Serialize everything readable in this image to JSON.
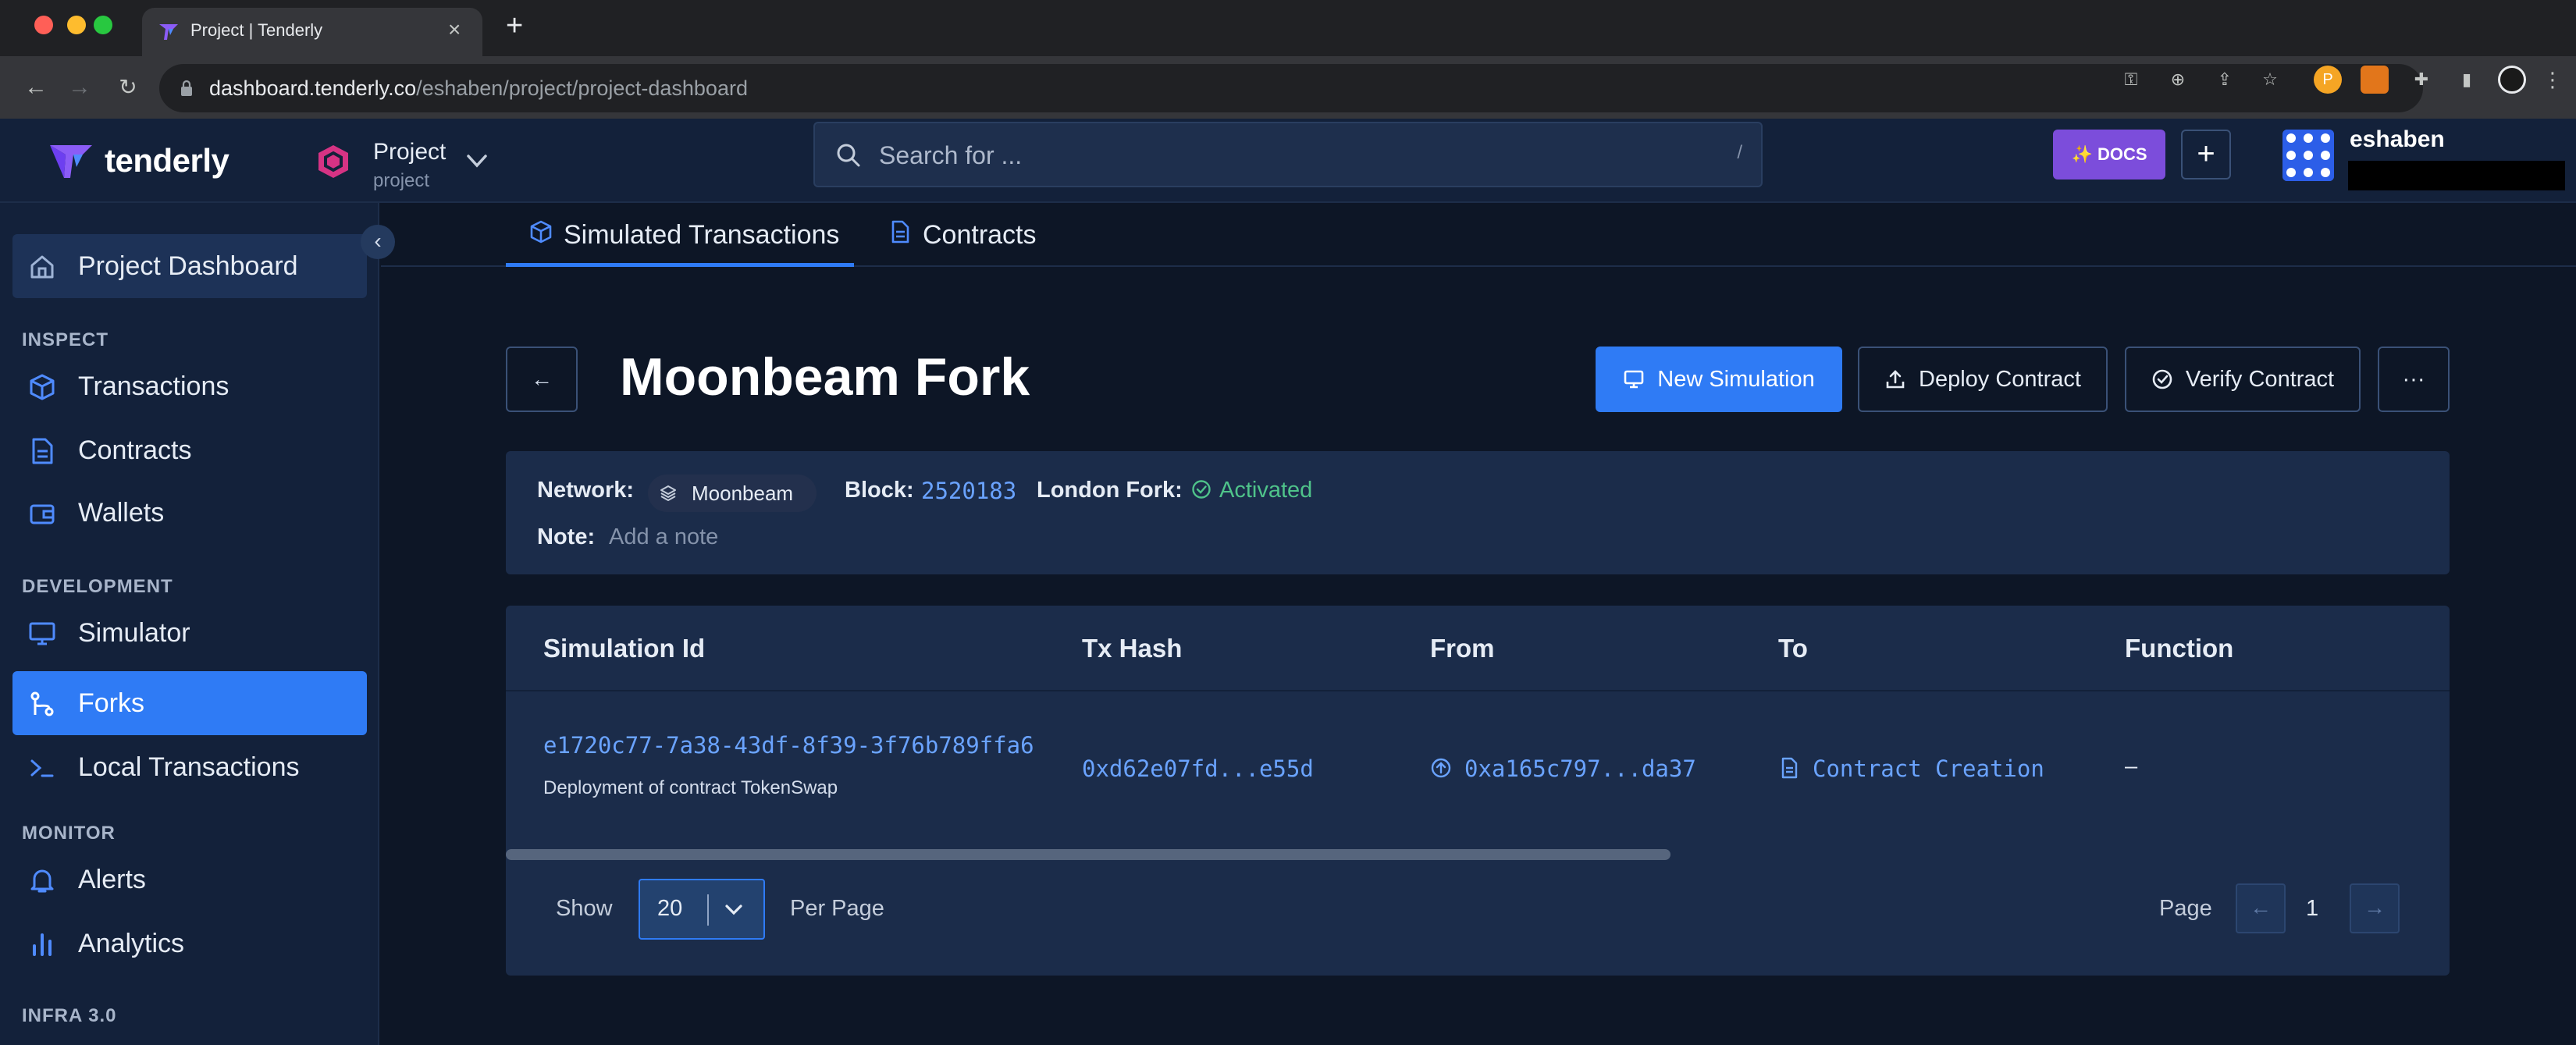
{
  "browser": {
    "tab_title": "Project | Tenderly",
    "url_host": "dashboard.tenderly.co",
    "url_path": "/eshaben/project/project-dashboard"
  },
  "header": {
    "logo_text": "tenderly",
    "project_name": "Project",
    "project_slug": "project",
    "search_placeholder": "Search for ...",
    "search_shortcut": "/",
    "docs_label": "✨ DOCS",
    "username": "eshaben"
  },
  "sidebar": {
    "project_dashboard": "Project Dashboard",
    "sections": {
      "inspect": "INSPECT",
      "development": "DEVELOPMENT",
      "monitor": "MONITOR",
      "infra": "INFRA 3.0"
    },
    "items": {
      "transactions": "Transactions",
      "contracts": "Contracts",
      "wallets": "Wallets",
      "simulator": "Simulator",
      "forks": "Forks",
      "local_transactions": "Local Transactions",
      "alerts": "Alerts",
      "analytics": "Analytics"
    }
  },
  "tabs": {
    "simulated": "Simulated Transactions",
    "contracts": "Contracts"
  },
  "page": {
    "title": "Moonbeam Fork",
    "actions": {
      "new_simulation": "New Simulation",
      "deploy_contract": "Deploy Contract",
      "verify_contract": "Verify Contract",
      "more": "···"
    }
  },
  "fork_info": {
    "network_label": "Network:",
    "network_value": "Moonbeam",
    "block_label": "Block:",
    "block_value": "2520183",
    "london_label": "London Fork:",
    "london_value": "Activated",
    "note_label": "Note:",
    "note_placeholder": "Add a note"
  },
  "table": {
    "headers": {
      "sim_id": "Simulation Id",
      "tx_hash": "Tx Hash",
      "from": "From",
      "to": "To",
      "function": "Function"
    },
    "rows": [
      {
        "sim_id": "e1720c77-7a38-43df-8f39-3f76b789ffa6",
        "description": "Deployment of contract TokenSwap",
        "tx_hash": "0xd62e07fd...e55d",
        "from": "0xa165c797...da37",
        "to": "Contract Creation",
        "function": "–"
      }
    ]
  },
  "pagination": {
    "show_label": "Show",
    "per_page_value": "20",
    "per_page_label": "Per Page",
    "page_label": "Page",
    "current_page": "1"
  },
  "colors": {
    "accent": "#2f7bf5",
    "link": "#6aa3ff",
    "success": "#4fc38a",
    "docs": "#7c4ddb",
    "background": "#0d1626",
    "panel": "#1b2c4a"
  }
}
